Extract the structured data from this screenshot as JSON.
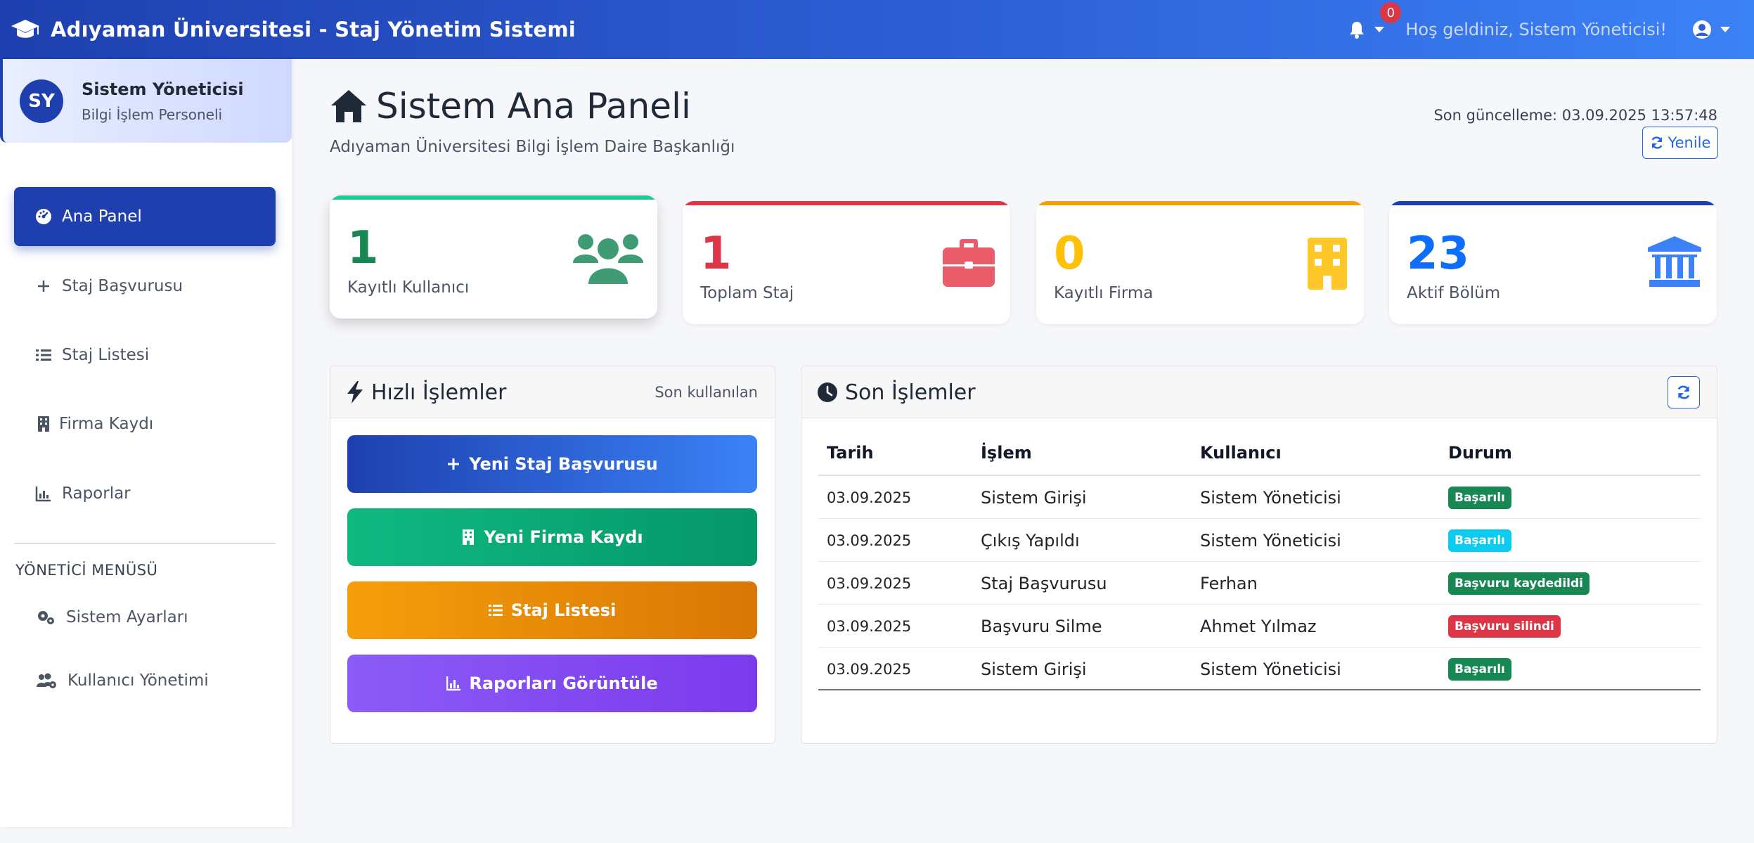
{
  "header": {
    "title": "Adıyaman Üniversitesi - Staj Yönetim Sistemi",
    "notification_count": "0",
    "welcome": "Hoş geldiniz, Sistem Yöneticisi!"
  },
  "sidebar": {
    "profile": {
      "initials": "SY",
      "name": "Sistem Yöneticisi",
      "role": "Bilgi İşlem Personeli"
    },
    "items": [
      {
        "label": "Ana Panel",
        "icon": "dashboard-icon",
        "active": true
      },
      {
        "label": "Staj Başvurusu",
        "icon": "plus-icon"
      },
      {
        "label": "Staj Listesi",
        "icon": "list-icon"
      },
      {
        "label": "Firma Kaydı",
        "icon": "building-icon"
      },
      {
        "label": "Raporlar",
        "icon": "chart-icon"
      }
    ],
    "admin_section_label": "YÖNETİCİ MENÜSÜ",
    "admin_items": [
      {
        "label": "Sistem Ayarları",
        "icon": "gears-icon"
      },
      {
        "label": "Kullanıcı Yönetimi",
        "icon": "users-gear-icon"
      }
    ]
  },
  "page": {
    "title": "Sistem Ana Paneli",
    "subtitle": "Adıyaman Üniversitesi Bilgi İşlem Daire Başkanlığı",
    "last_update": "Son güncelleme: 03.09.2025 13:57:48",
    "refresh_label": "Yenile"
  },
  "stats": [
    {
      "value": "1",
      "label": "Kayıtlı Kullanıcı",
      "color": "#198754",
      "icon": "users-icon"
    },
    {
      "value": "1",
      "label": "Toplam Staj",
      "color": "#dc3545",
      "icon": "briefcase-icon"
    },
    {
      "value": "0",
      "label": "Kayıtlı Firma",
      "color": "#ffc107",
      "icon": "building-icon"
    },
    {
      "value": "23",
      "label": "Aktif Bölüm",
      "color": "#0d6efd",
      "icon": "university-icon"
    }
  ],
  "quick_actions": {
    "title": "Hızlı İşlemler",
    "note": "Son kullanılan",
    "buttons": [
      {
        "label": "Yeni Staj Başvurusu",
        "icon": "plus-icon"
      },
      {
        "label": "Yeni Firma Kaydı",
        "icon": "building-icon"
      },
      {
        "label": "Staj Listesi",
        "icon": "list-icon"
      },
      {
        "label": "Raporları Görüntüle",
        "icon": "chart-icon"
      }
    ]
  },
  "recent": {
    "title": "Son İşlemler",
    "columns": [
      "Tarih",
      "İşlem",
      "Kullanıcı",
      "Durum"
    ],
    "rows": [
      {
        "date": "03.09.2025",
        "action": "Sistem Girişi",
        "user": "Sistem Yöneticisi",
        "status": "Başarılı",
        "status_color": "#198754"
      },
      {
        "date": "03.09.2025",
        "action": "Çıkış Yapıldı",
        "user": "Sistem Yöneticisi",
        "status": "Başarılı",
        "status_color": "#0dcaf0"
      },
      {
        "date": "03.09.2025",
        "action": "Staj Başvurusu",
        "user": "Ferhan",
        "status": "Başvuru kaydedildi",
        "status_color": "#198754"
      },
      {
        "date": "03.09.2025",
        "action": "Başvuru Silme",
        "user": "Ahmet Yılmaz",
        "status": "Başvuru silindi",
        "status_color": "#dc3545"
      },
      {
        "date": "03.09.2025",
        "action": "Sistem Girişi",
        "user": "Sistem Yöneticisi",
        "status": "Başarılı",
        "status_color": "#198754"
      }
    ]
  }
}
